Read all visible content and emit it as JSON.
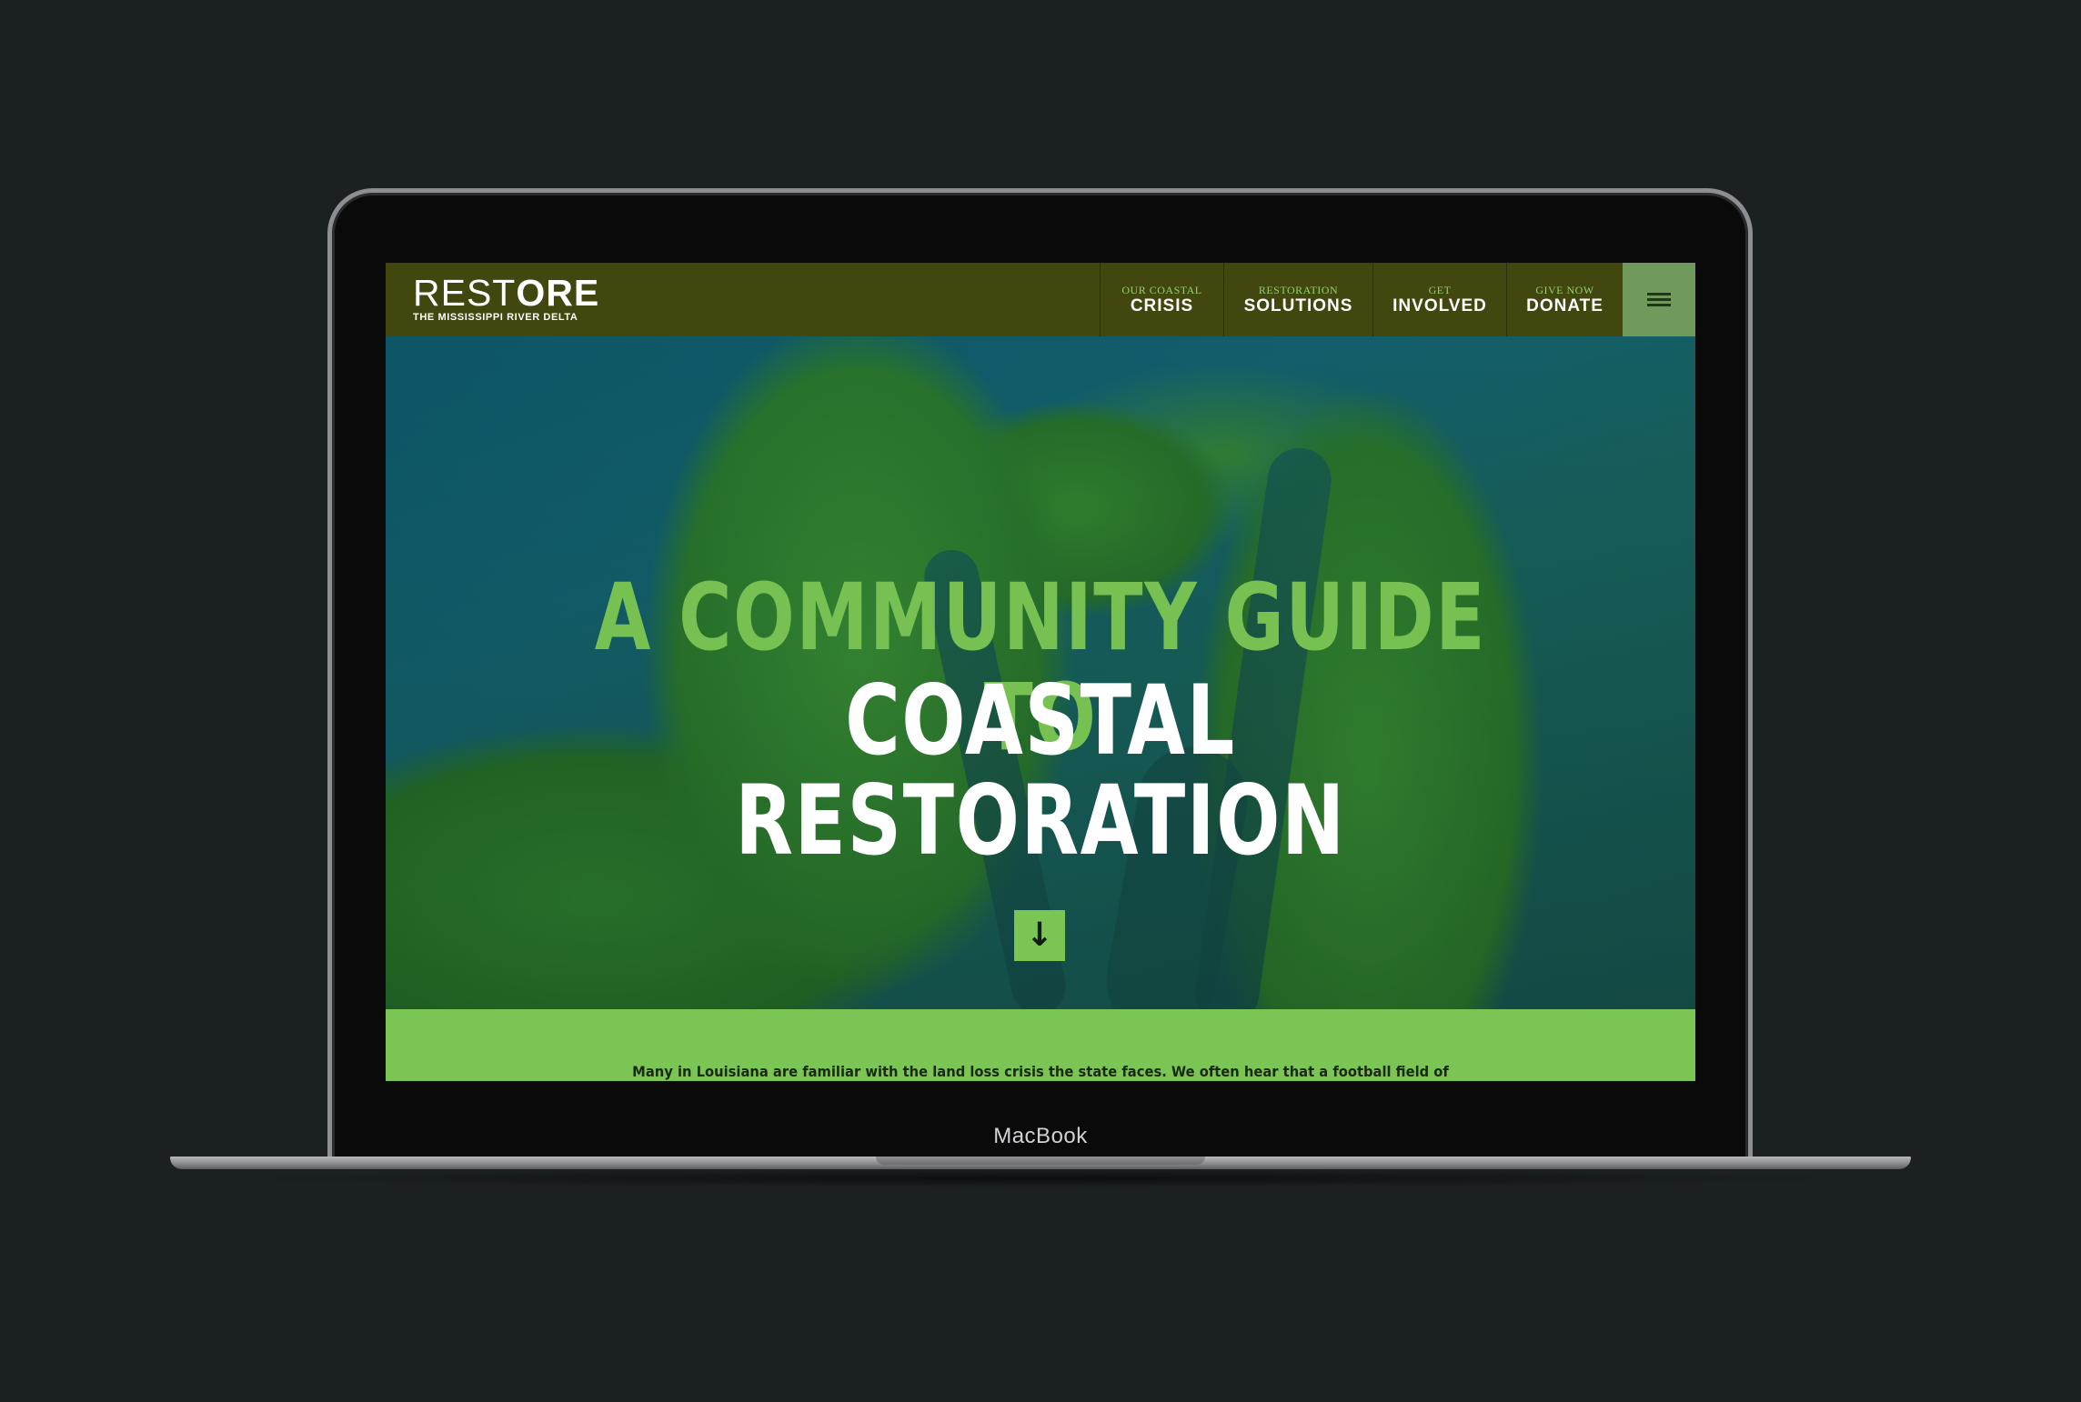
{
  "site": {
    "logo_light": "REST",
    "logo_bold": "ORE",
    "logo_sub": "THE MISSISSIPPI RIVER DELTA"
  },
  "nav": {
    "items": [
      {
        "small": "OUR COASTAL",
        "big": "CRISIS"
      },
      {
        "small": "RESTORATION",
        "big": "SOLUTIONS"
      },
      {
        "small": "GET",
        "big": "INVOLVED"
      },
      {
        "small": "GIVE NOW",
        "big": "DONATE"
      }
    ],
    "menu_icon": "hamburger-menu-icon"
  },
  "hero": {
    "line1": "A COMMUNITY GUIDE TO",
    "line2": "COASTAL RESTORATION",
    "scroll_icon": "arrow-down-icon",
    "scroll_glyph": "↓"
  },
  "intro": {
    "text": "Many in Louisiana are familiar with the land loss crisis the state faces. We often hear that a football field of"
  },
  "device": {
    "label": "MacBook"
  },
  "colors": {
    "nav_bg": "#41470f",
    "accent_green": "#7ac554",
    "menu_bg": "#6f9a5c",
    "page_bg": "#1b2022"
  }
}
